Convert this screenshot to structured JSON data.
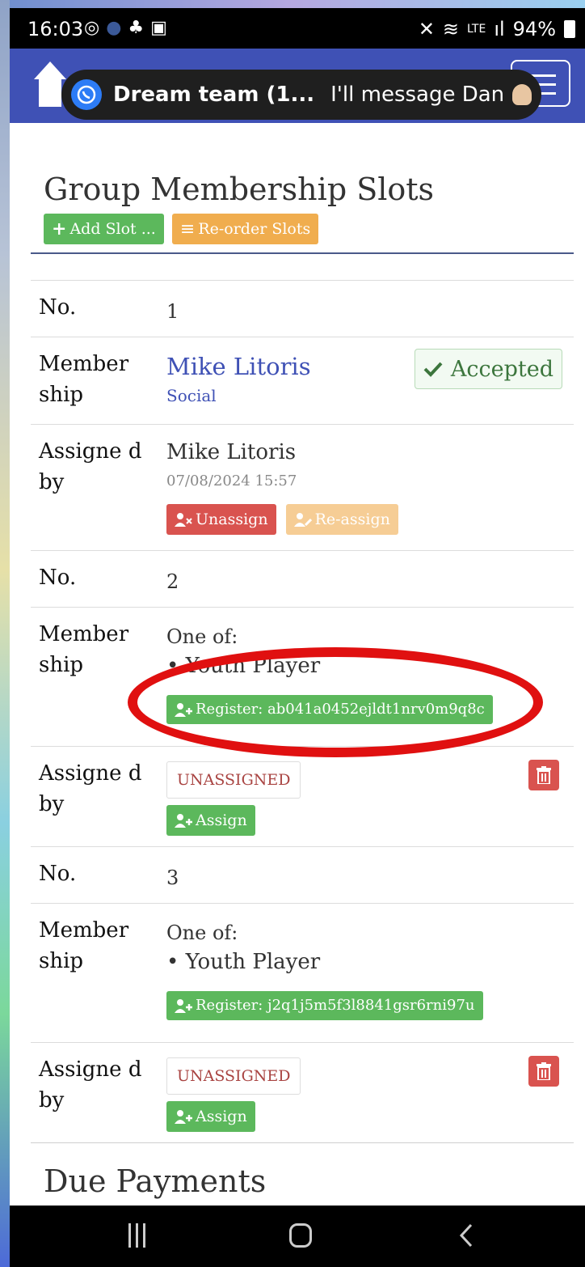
{
  "status_bar": {
    "time": "16:03",
    "left_icons": [
      "whatsapp-icon",
      "facebook-icon",
      "figure-icon",
      "image-icon"
    ],
    "right_icons": [
      "mute-icon",
      "wifi-icon",
      "volte-icon",
      "signal-icon"
    ],
    "battery": "94%"
  },
  "notification": {
    "app_icon": "whatsapp-icon",
    "title": "Dream team (1...",
    "message": "I'll message Dan"
  },
  "page": {
    "title": "Group Membership Slots",
    "add_slot_label": "Add Slot ...",
    "reorder_label": "Re-order Slots",
    "due_payments_title": "Due Payments"
  },
  "slots": [
    {
      "no_label": "No.",
      "no": "1",
      "membership_label": "Member ship",
      "member_name": "Mike Litoris",
      "member_type": "Social",
      "status": "Accepted",
      "assigned_label": "Assigne d by",
      "assigned_by": "Mike Litoris",
      "assigned_date": "07/08/2024 15:57",
      "unassign_label": "Unassign",
      "reassign_label": "Re-assign"
    },
    {
      "no_label": "No.",
      "no": "2",
      "membership_label": "Member ship",
      "one_of": "One of:",
      "option": "Youth Player",
      "register_label": "Register: ab041a0452ejldt1nrv0m9q8c",
      "assigned_label": "Assigne d by",
      "unassigned": "UNASSIGNED",
      "assign_label": "Assign"
    },
    {
      "no_label": "No.",
      "no": "3",
      "membership_label": "Member ship",
      "one_of": "One of:",
      "option": "Youth Player",
      "register_label": "Register: j2q1j5m5f3l8841gsr6rni97u",
      "assigned_label": "Assigne d by",
      "unassigned": "UNASSIGNED",
      "assign_label": "Assign"
    }
  ],
  "colors": {
    "navbar": "#3f51b5",
    "success": "#5cb85c",
    "warning": "#f0ad4e",
    "danger": "#d9534f",
    "annotation": "#e01010"
  }
}
